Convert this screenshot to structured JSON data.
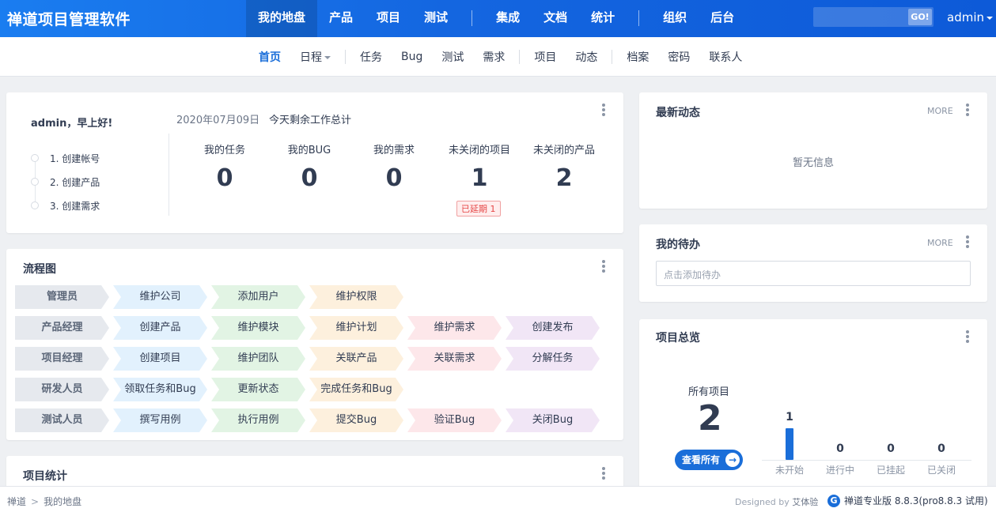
{
  "brand": "禅道项目管理软件",
  "mainnav": [
    "我的地盘",
    "产品",
    "项目",
    "测试",
    "集成",
    "文档",
    "统计",
    "组织",
    "后台"
  ],
  "search": {
    "go": "GO!"
  },
  "user": "admin",
  "subnav": [
    "首页",
    "日程",
    "任务",
    "Bug",
    "测试",
    "需求",
    "项目",
    "动态",
    "档案",
    "密码",
    "联系人"
  ],
  "welcome": {
    "greeting": "admin，早上好!",
    "steps": [
      "1. 创建帐号",
      "2. 创建产品",
      "3. 创建需求"
    ],
    "date": "2020年07月09日",
    "summary_title": "今天剩余工作总计",
    "stats": [
      {
        "label": "我的任务",
        "value": "0"
      },
      {
        "label": "我的BUG",
        "value": "0"
      },
      {
        "label": "我的需求",
        "value": "0"
      },
      {
        "label": "未关闭的项目",
        "value": "1"
      },
      {
        "label": "未关闭的产品",
        "value": "2"
      }
    ],
    "delay_badge": "已延期 1"
  },
  "flow": {
    "title": "流程图",
    "rows": [
      {
        "role": "管理员",
        "steps": [
          "维护公司",
          "添加用户",
          "维护权限"
        ]
      },
      {
        "role": "产品经理",
        "steps": [
          "创建产品",
          "维护模块",
          "维护计划",
          "维护需求",
          "创建发布"
        ]
      },
      {
        "role": "项目经理",
        "steps": [
          "创建项目",
          "维护团队",
          "关联产品",
          "关联需求",
          "分解任务"
        ]
      },
      {
        "role": "研发人员",
        "steps": [
          "领取任务和Bug",
          "更新状态",
          "完成任务和Bug"
        ]
      },
      {
        "role": "测试人员",
        "steps": [
          "撰写用例",
          "执行用例",
          "提交Bug",
          "验证Bug",
          "关闭Bug"
        ]
      }
    ],
    "colors": [
      "#e2f1fd",
      "#e2f4e4",
      "#fdf0dd",
      "#fde7ea",
      "#f1e6f6"
    ],
    "role_color": "#e6e9ee"
  },
  "project_stats": {
    "title": "项目统计"
  },
  "dynamic": {
    "title": "最新动态",
    "more": "MORE",
    "empty": "暂无信息"
  },
  "todo": {
    "title": "我的待办",
    "more": "MORE",
    "placeholder": "点击添加待办"
  },
  "overview": {
    "title": "项目总览",
    "all_label": "所有项目",
    "all_value": "2",
    "view_all": "查看所有",
    "bars": [
      {
        "label": "未开始",
        "value": 1
      },
      {
        "label": "进行中",
        "value": 0
      },
      {
        "label": "已挂起",
        "value": 0
      },
      {
        "label": "已关闭",
        "value": 0
      }
    ]
  },
  "footer": {
    "breadcrumb": [
      "禅道",
      "我的地盘"
    ],
    "designed_by": "Designed by",
    "designer": "艾体验",
    "version": "禅道专业版 8.8.3(pro8.8.3 试用)"
  },
  "accent": "#1a6ed9"
}
